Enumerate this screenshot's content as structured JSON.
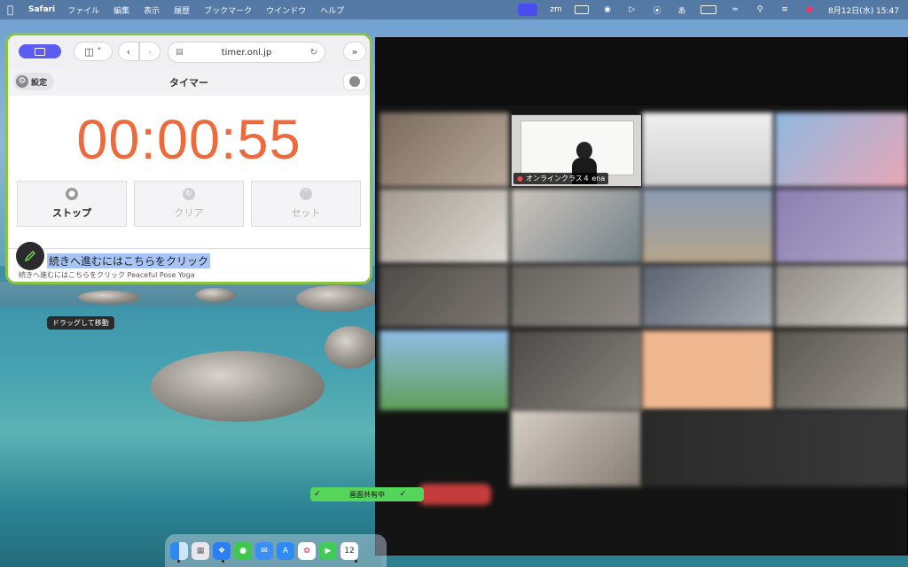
{
  "menubar": {
    "app": "Safari",
    "items": [
      "ファイル",
      "編集",
      "表示",
      "履歴",
      "ブックマーク",
      "ウインドウ",
      "ヘルプ"
    ],
    "ime": "あ",
    "clock": "8月12日(水) 15:47",
    "zm_label": "zm"
  },
  "safari": {
    "url": "timer.onl.jp",
    "settings_label": "設定",
    "title": "タイマー",
    "timer": "00:00:55",
    "buttons": {
      "stop": "ストップ",
      "clear": "クリア",
      "set": "セット"
    },
    "link_main": "続きへ進むにはこちらをクリック",
    "link_sub": "続きへ進むにはこちらをクリック Peaceful Pose Yoga"
  },
  "tooltip": "ドラッグして移動",
  "zoom": {
    "active_name": "オンラインクラス４ ena",
    "sharing_label": "画面共有中"
  },
  "dock": {
    "calendar_day": "12"
  }
}
